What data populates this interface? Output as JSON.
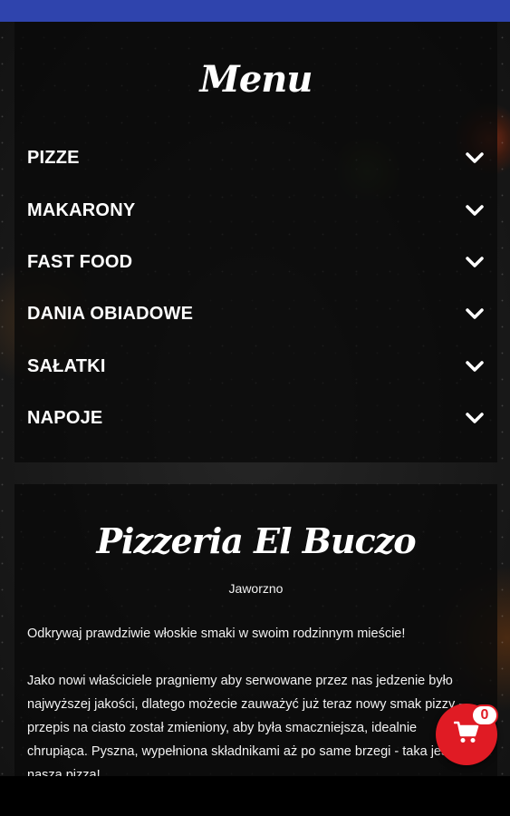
{
  "menu": {
    "title": "Menu",
    "items": [
      {
        "label": "PIZZE"
      },
      {
        "label": "MAKARONY"
      },
      {
        "label": "FAST FOOD"
      },
      {
        "label": "DANIA OBIADOWE"
      },
      {
        "label": "SAŁATKI"
      },
      {
        "label": "NAPOJE"
      }
    ]
  },
  "about": {
    "title": "Pizzeria El Buczo",
    "city": "Jaworzno",
    "paragraph1": "Odkrywaj prawdziwie włoskie smaki w swoim rodzinnym mieście!",
    "paragraph2": "Jako nowi właściciele pragniemy aby serwowane przez nas jedzenie było najwyższej jakości, dlatego możecie zauważyć już teraz nowy smak pizzy - przepis na ciasto został zmieniony, aby była smaczniejsza, idealnie chrupiąca. Pyszna, wypełniona składnikami aż po same brzegi - taka jest nasza pizza!"
  },
  "cart": {
    "count": "0",
    "icon": "cart-icon"
  },
  "colors": {
    "status_bar": "#2f44ad",
    "cart_button": "#e01b24"
  }
}
